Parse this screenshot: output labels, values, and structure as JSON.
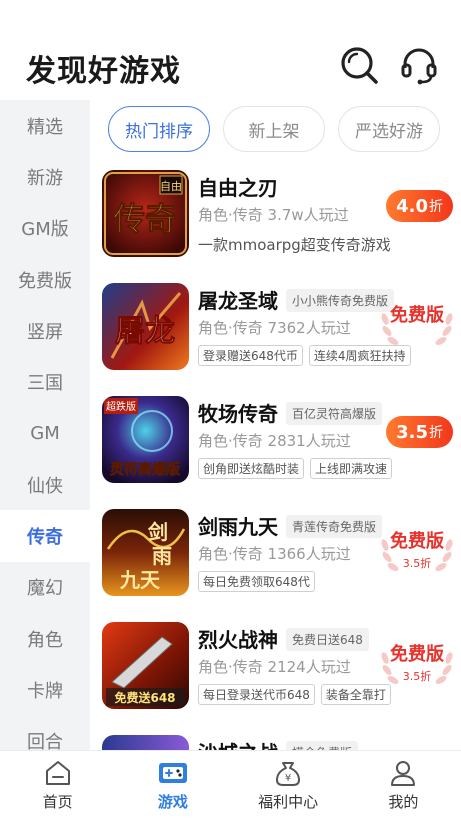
{
  "header": {
    "title": "发现好游戏",
    "search_icon": "search-icon",
    "service_icon": "headset-icon"
  },
  "sidebar": {
    "items": [
      {
        "label": "精选",
        "active": false
      },
      {
        "label": "新游",
        "active": false
      },
      {
        "label": "GM版",
        "active": false
      },
      {
        "label": "免费版",
        "active": false
      },
      {
        "label": "竖屏",
        "active": false
      },
      {
        "label": "三国",
        "active": false
      },
      {
        "label": "GM",
        "active": false
      },
      {
        "label": "仙侠",
        "active": false
      },
      {
        "label": "传奇",
        "active": true
      },
      {
        "label": "魔幻",
        "active": false
      },
      {
        "label": "角色",
        "active": false
      },
      {
        "label": "卡牌",
        "active": false
      },
      {
        "label": "回合",
        "active": false
      }
    ]
  },
  "tabs": [
    {
      "label": "热门排序",
      "active": true
    },
    {
      "label": "新上架",
      "active": false
    },
    {
      "label": "严选好游",
      "active": false
    }
  ],
  "games": [
    {
      "name": "自由之刃",
      "tag": "",
      "meta": "角色·传奇  3.7w人玩过",
      "desc": "一款mmoarpg超变传奇游戏",
      "chips": [],
      "badge": {
        "type": "discount",
        "value": "4.0",
        "unit": "折"
      },
      "cover": {
        "text": "传奇",
        "small": "自由"
      }
    },
    {
      "name": "屠龙圣域",
      "tag": "小小熊传奇免费版",
      "meta": "角色·传奇  7362人玩过",
      "desc": "",
      "chips": [
        "登录赠送648代币",
        "连续4周疯狂扶持"
      ],
      "badge": {
        "type": "free",
        "text": "免费版",
        "sub": ""
      },
      "cover": {
        "text": "屠龙"
      }
    },
    {
      "name": "牧场传奇",
      "tag": "百亿灵符高爆版",
      "meta": "角色·传奇  2831人玩过",
      "desc": "",
      "chips": [
        "创角即送炫酷时装",
        "上线即满攻速"
      ],
      "badge": {
        "type": "discount",
        "value": "3.5",
        "unit": "折"
      },
      "cover": {
        "text": "灵符高爆版",
        "small": "超跌版"
      }
    },
    {
      "name": "剑雨九天",
      "tag": "青莲传奇免费版",
      "meta": "角色·传奇  1366人玩过",
      "desc": "",
      "chips": [
        "每日免费领取648代"
      ],
      "badge": {
        "type": "free",
        "text": "免费版",
        "sub": "3.5折"
      },
      "cover": {
        "text": "剑雨九天"
      }
    },
    {
      "name": "烈火战神",
      "tag": "免费日送648",
      "meta": "角色·传奇  2124人玩过",
      "desc": "",
      "chips": [
        "每日登录送代币648",
        "装备全靠打"
      ],
      "badge": {
        "type": "free",
        "text": "免费版",
        "sub": "3.5折"
      },
      "cover": {
        "text": "免费送648"
      }
    },
    {
      "name": "沙城之战",
      "tag": "摸金免费版",
      "meta": "",
      "desc": "",
      "chips": [],
      "badge": {
        "type": "none"
      },
      "cover": {
        "text": ""
      }
    }
  ],
  "bottom_nav": [
    {
      "label": "首页",
      "icon": "home-icon",
      "active": false
    },
    {
      "label": "游戏",
      "icon": "gamepad-icon",
      "active": true
    },
    {
      "label": "福利中心",
      "icon": "money-bag-icon",
      "active": false
    },
    {
      "label": "我的",
      "icon": "user-icon",
      "active": false
    }
  ],
  "colors": {
    "accent": "#3b6fe0",
    "discount": "#f2371c",
    "free": "#e8322b",
    "sidebar_bg": "#f2f3f5"
  }
}
